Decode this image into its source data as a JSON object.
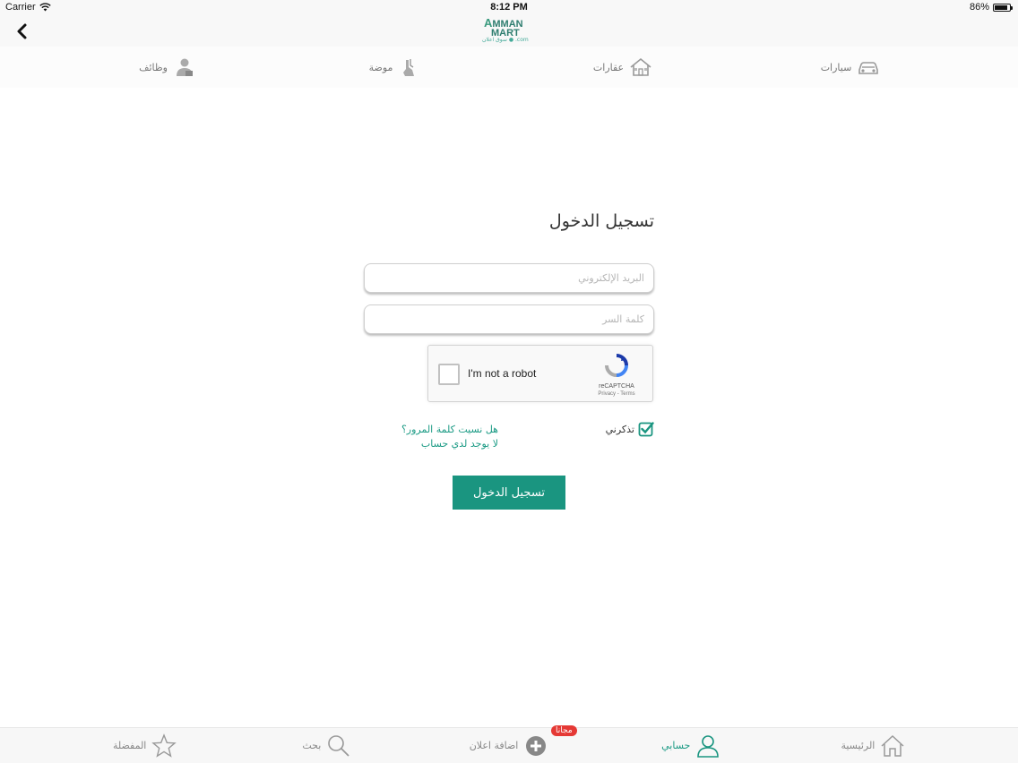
{
  "status_bar": {
    "carrier": "Carrier",
    "time": "8:12 PM",
    "battery": "86%",
    "battery_level": 0.86
  },
  "header": {
    "logo_main_a": "A",
    "logo_main_line1": "MMAN",
    "logo_main_line2": "MART",
    "logo_sub": "سوق اعلان ● .com"
  },
  "categories": [
    {
      "label": "سيارات",
      "icon": "car-icon"
    },
    {
      "label": "عقارات",
      "icon": "house-icon"
    },
    {
      "label": "موضة",
      "icon": "fashion-icon"
    },
    {
      "label": "وظائف",
      "icon": "jobs-icon"
    }
  ],
  "login": {
    "title": "تسجيل الدخول",
    "email_placeholder": "البريد الإلكتروني",
    "password_placeholder": "كلمة السر",
    "recaptcha_text": "I'm not a robot",
    "recaptcha_brand": "reCAPTCHA",
    "recaptcha_links": "Privacy - Terms",
    "remember_label": "تذكرني",
    "remember_checked": true,
    "forgot_password": "هل نسيت كلمة المرور؟",
    "no_account": "لا يوجد لدي حساب",
    "submit_label": "تسجيل الدخول"
  },
  "tabs": [
    {
      "label": "الرئيسية",
      "icon": "home-icon",
      "active": false
    },
    {
      "label": "حسابي",
      "icon": "user-icon",
      "active": true
    },
    {
      "label": "اضافة اعلان",
      "icon": "add-icon",
      "active": false,
      "badge": "مجانا"
    },
    {
      "label": "بحث",
      "icon": "search-icon",
      "active": false
    },
    {
      "label": "المفضلة",
      "icon": "star-icon",
      "active": false
    }
  ],
  "colors": {
    "accent": "#1a9580",
    "link": "#1a9a84"
  }
}
